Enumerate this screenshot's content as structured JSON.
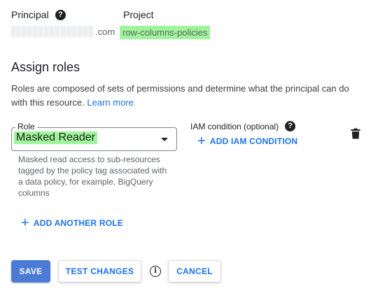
{
  "principal": {
    "label": "Principal",
    "value_suffix": ".com",
    "help_icon": "question-circle-icon"
  },
  "project": {
    "label": "Project",
    "value": "row-columns-policies",
    "highlight_color": "#9ef59a"
  },
  "assign_roles": {
    "title": "Assign roles",
    "description": "Roles are composed of sets of permissions and determine what the principal can do with this resource.",
    "learn_more": "Learn more"
  },
  "role_field": {
    "label": "Role",
    "value": "Masked Reader",
    "hint": "Masked read access to sub-resources tagged by the policy tag associated with a data policy, for example, BigQuery columns",
    "arrow_icon": "dropdown-arrow-icon"
  },
  "iam_condition": {
    "label": "IAM condition (optional)",
    "add_label": "ADD IAM CONDITION",
    "help_icon": "question-circle-icon"
  },
  "delete_icon": "trash-icon",
  "add_another_role_label": "ADD ANOTHER ROLE",
  "actions": {
    "save": "SAVE",
    "test_changes": "TEST CHANGES",
    "info_icon": "info-icon",
    "cancel": "CANCEL"
  },
  "colors": {
    "primary_button": "#4b7bd6",
    "link": "#1a73e8"
  }
}
